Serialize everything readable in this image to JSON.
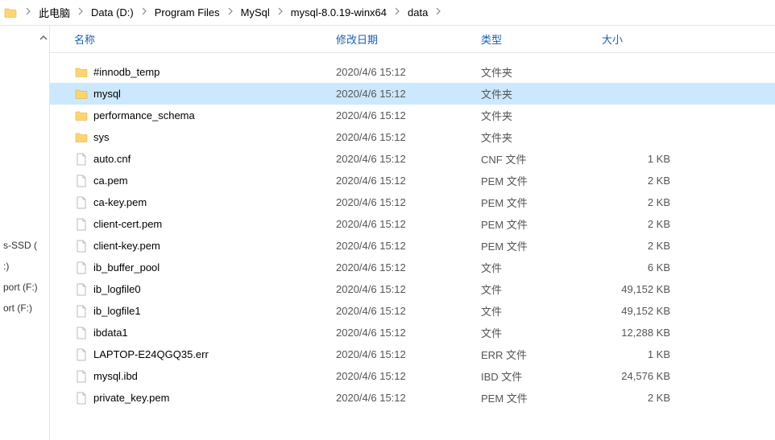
{
  "breadcrumb": {
    "items": [
      "此电脑",
      "Data (D:)",
      "Program Files",
      "MySql",
      "mysql-8.0.19-winx64",
      "data"
    ]
  },
  "columns": {
    "name": "名称",
    "date": "修改日期",
    "type": "类型",
    "size": "大小"
  },
  "sidebar": {
    "items": [
      "s-SSD (",
      ":)",
      "port (F:)",
      "ort (F:)"
    ]
  },
  "files": [
    {
      "icon": "folder",
      "name": "#innodb_temp",
      "date": "2020/4/6 15:12",
      "type": "文件夹",
      "size": "",
      "selected": false
    },
    {
      "icon": "folder",
      "name": "mysql",
      "date": "2020/4/6 15:12",
      "type": "文件夹",
      "size": "",
      "selected": true
    },
    {
      "icon": "folder",
      "name": "performance_schema",
      "date": "2020/4/6 15:12",
      "type": "文件夹",
      "size": "",
      "selected": false
    },
    {
      "icon": "folder",
      "name": "sys",
      "date": "2020/4/6 15:12",
      "type": "文件夹",
      "size": "",
      "selected": false
    },
    {
      "icon": "file",
      "name": "auto.cnf",
      "date": "2020/4/6 15:12",
      "type": "CNF 文件",
      "size": "1 KB",
      "selected": false
    },
    {
      "icon": "file",
      "name": "ca.pem",
      "date": "2020/4/6 15:12",
      "type": "PEM 文件",
      "size": "2 KB",
      "selected": false
    },
    {
      "icon": "file",
      "name": "ca-key.pem",
      "date": "2020/4/6 15:12",
      "type": "PEM 文件",
      "size": "2 KB",
      "selected": false
    },
    {
      "icon": "file",
      "name": "client-cert.pem",
      "date": "2020/4/6 15:12",
      "type": "PEM 文件",
      "size": "2 KB",
      "selected": false
    },
    {
      "icon": "file",
      "name": "client-key.pem",
      "date": "2020/4/6 15:12",
      "type": "PEM 文件",
      "size": "2 KB",
      "selected": false
    },
    {
      "icon": "file",
      "name": "ib_buffer_pool",
      "date": "2020/4/6 15:12",
      "type": "文件",
      "size": "6 KB",
      "selected": false
    },
    {
      "icon": "file",
      "name": "ib_logfile0",
      "date": "2020/4/6 15:12",
      "type": "文件",
      "size": "49,152 KB",
      "selected": false
    },
    {
      "icon": "file",
      "name": "ib_logfile1",
      "date": "2020/4/6 15:12",
      "type": "文件",
      "size": "49,152 KB",
      "selected": false
    },
    {
      "icon": "file",
      "name": "ibdata1",
      "date": "2020/4/6 15:12",
      "type": "文件",
      "size": "12,288 KB",
      "selected": false
    },
    {
      "icon": "file",
      "name": "LAPTOP-E24QGQ35.err",
      "date": "2020/4/6 15:12",
      "type": "ERR 文件",
      "size": "1 KB",
      "selected": false
    },
    {
      "icon": "file",
      "name": "mysql.ibd",
      "date": "2020/4/6 15:12",
      "type": "IBD 文件",
      "size": "24,576 KB",
      "selected": false
    },
    {
      "icon": "file",
      "name": "private_key.pem",
      "date": "2020/4/6 15:12",
      "type": "PEM 文件",
      "size": "2 KB",
      "selected": false
    }
  ]
}
